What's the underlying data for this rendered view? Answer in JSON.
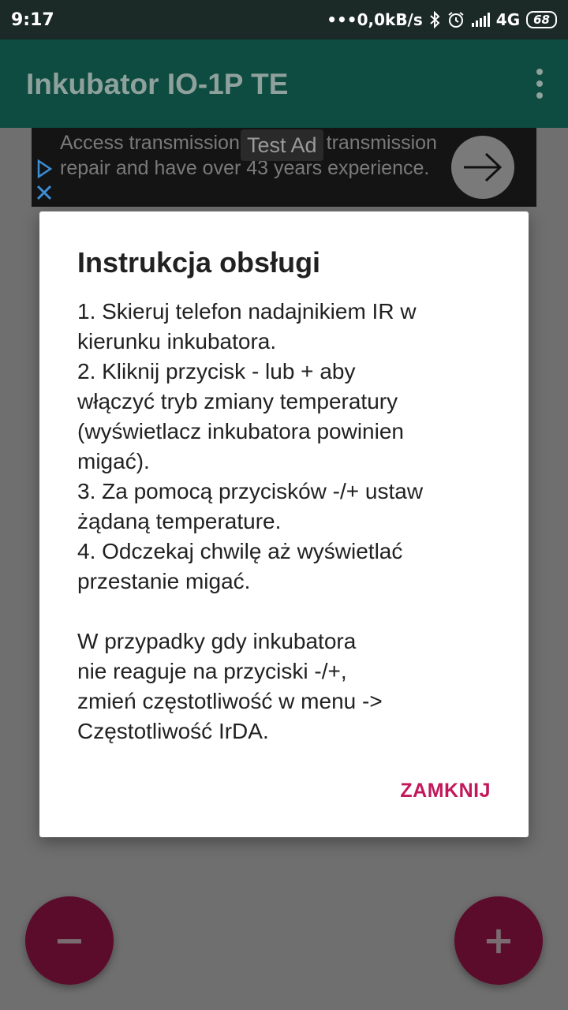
{
  "status_bar": {
    "time": "9:17",
    "network_speed": "•••0,0kB/s",
    "network_type": "4G",
    "battery": "68",
    "icons": [
      "bluetooth-icon",
      "alarm-icon",
      "signal-icon",
      "battery-icon"
    ]
  },
  "app_bar": {
    "title": "Inkubator IO-1P TE",
    "menu_icon": "overflow-menu-icon"
  },
  "ad": {
    "label": "Test Ad",
    "text": "Access transmission trades in transmission repair and have over 43 years experience.",
    "cta_icon": "arrow-right-icon"
  },
  "dialog": {
    "title": "Instrukcja obsługi",
    "lines": [
      "1. Skieruj telefon nadajnikiem IR w",
      "kierunku inkubatora.",
      "2. Kliknij przycisk - lub + aby",
      "włączyć tryb zmiany temperatury",
      "(wyświetlacz inkubatora powinien",
      "migać).",
      "3. Za pomocą przycisków -/+ ustaw",
      "żądaną temperature.",
      "4. Odczekaj chwilę aż wyświetlać",
      "przestanie migać."
    ],
    "note_lines": [
      "W przypadky gdy inkubatora",
      "nie reaguje na przyciski -/+,",
      "zmień częstotliwość w menu ->",
      "Częstotliwość IrDA."
    ],
    "close_label": "ZAMKNIJ"
  },
  "fabs": {
    "minus_label": "−",
    "plus_label": "+"
  },
  "colors": {
    "app_bar": "#0e4b40",
    "accent": "#c2185b",
    "fab": "#5c0c2b"
  }
}
